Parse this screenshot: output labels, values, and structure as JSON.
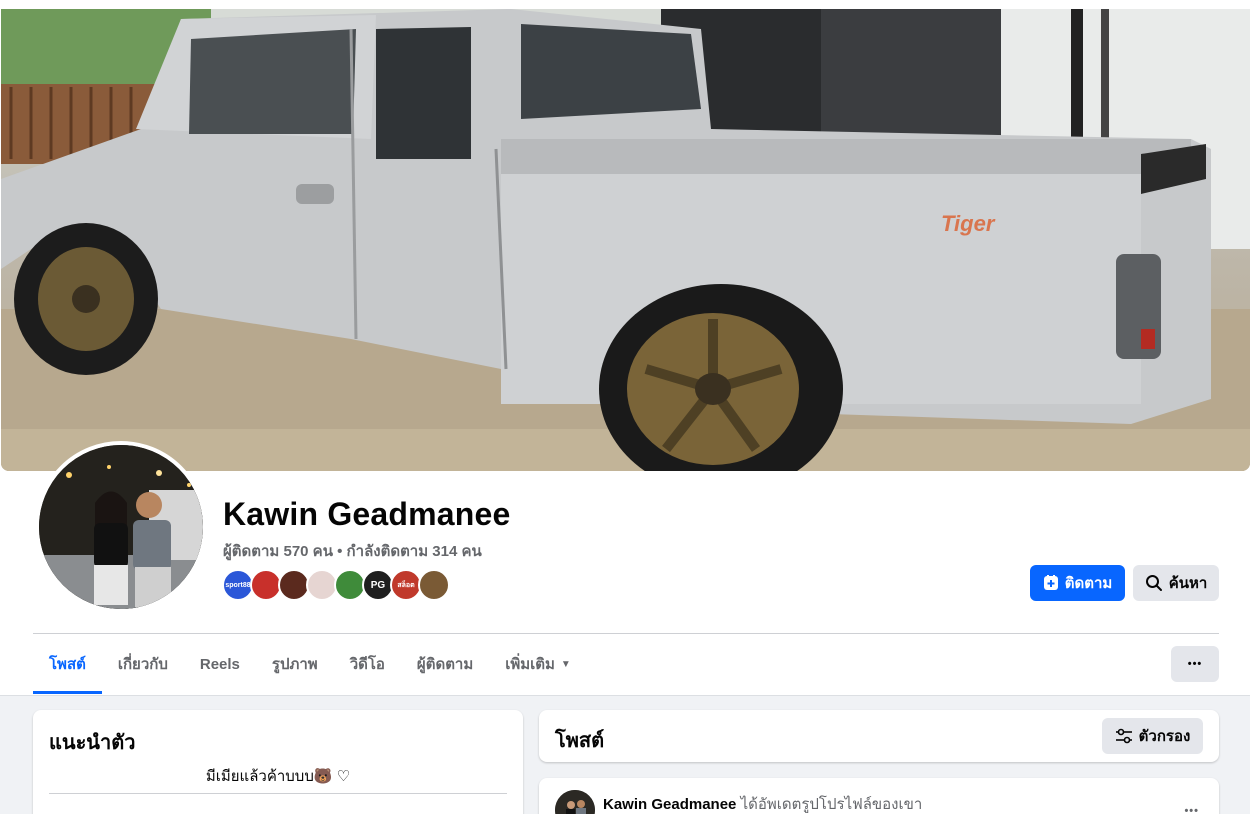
{
  "profile": {
    "name": "Kawin Geadmanee",
    "stats": "ผู้ติดตาม 570 คน • กำลังติดตาม 314 คน",
    "friend_avatars": [
      {
        "label": "sport88",
        "color": "#2b57d8"
      },
      {
        "label": "",
        "color": "#c8302b"
      },
      {
        "label": "",
        "color": "#5b2a1e"
      },
      {
        "label": "",
        "color": "#e6d5d2"
      },
      {
        "label": "",
        "color": "#3f8b3a"
      },
      {
        "label": "PG",
        "color": "#1f1f1f"
      },
      {
        "label": "สล็อต",
        "color": "#c0392b"
      },
      {
        "label": "",
        "color": "#7a5a35"
      }
    ]
  },
  "actions": {
    "follow_label": "ติดตาม",
    "search_label": "ค้นหา",
    "more_label": "•••"
  },
  "tabs": [
    {
      "label": "โพสต์",
      "active": true
    },
    {
      "label": "เกี่ยวกับ",
      "active": false
    },
    {
      "label": "Reels",
      "active": false
    },
    {
      "label": "รูปภาพ",
      "active": false
    },
    {
      "label": "วิดีโอ",
      "active": false
    },
    {
      "label": "ผู้ติดตาม",
      "active": false
    },
    {
      "label": "เพิ่มเติม",
      "active": false
    }
  ],
  "intro": {
    "title": "แนะนำตัว",
    "bio": "มีเมียแล้วค้าบบบ🐻 ♡"
  },
  "posts": {
    "title": "โพสต์",
    "filter_label": "ตัวกรอง"
  },
  "post": {
    "author": "Kawin Geadmanee",
    "action_text": "ได้อัพเดตรูปโปรไฟล์ของเขา",
    "menu_label": "•••"
  },
  "colors": {
    "accent": "#0866ff",
    "secondary_button": "#e4e6eb",
    "page_bg": "#f0f2f5",
    "muted_text": "#65676b"
  }
}
